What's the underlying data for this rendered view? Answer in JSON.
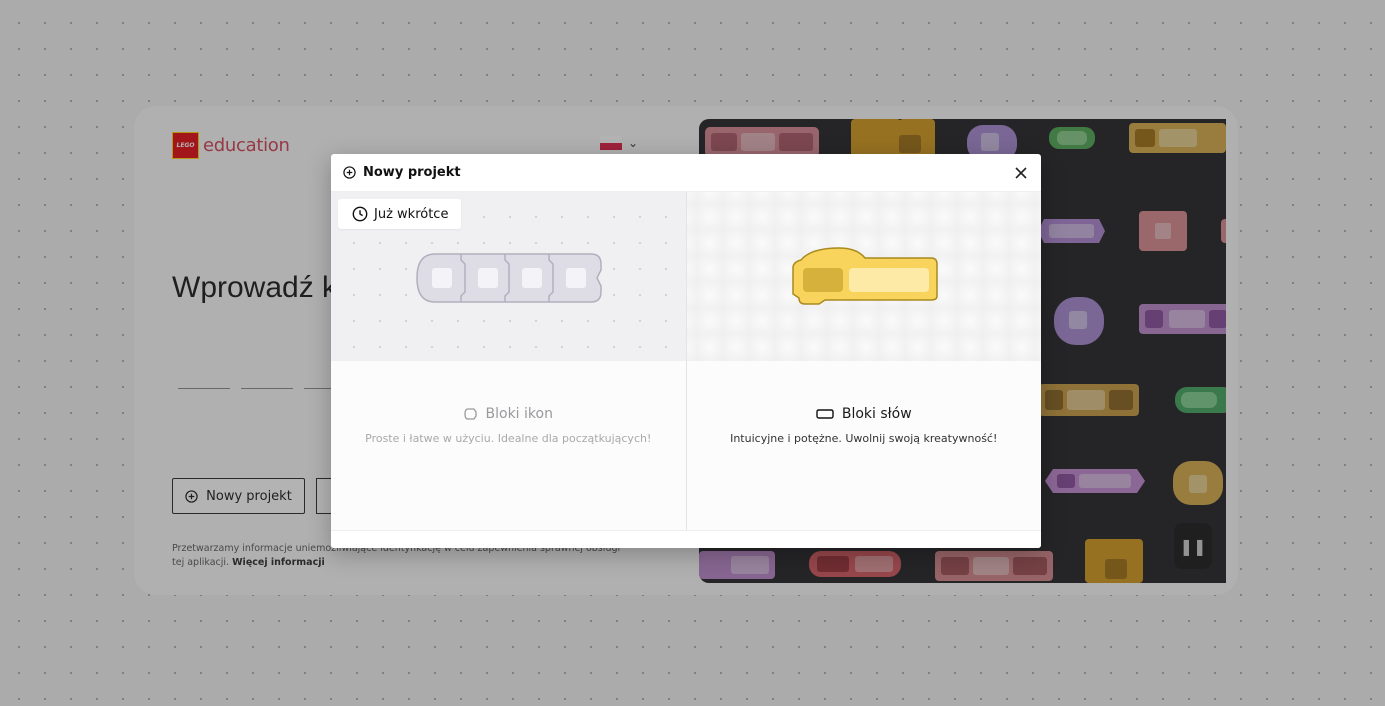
{
  "background": {
    "logo": {
      "badge_text": "LEGO",
      "wordmark": "education"
    },
    "heading": "Wprowadź k",
    "new_project_button": "Nowy projekt",
    "privacy_text": "Przetwarzamy informacje uniemożliwiające identyfikację w celu zapewnienia sprawnej obsługi tej aplikacji.",
    "privacy_link": "Więcej informacji",
    "flag_colors": [
      "#ffffff",
      "#dc143c"
    ]
  },
  "modal": {
    "title": "Nowy projekt",
    "close_icon": "close-icon",
    "options": [
      {
        "badge": "Już wkrótce",
        "title": "Bloki ikon",
        "description": "Proste i łatwe w użyciu. Idealne dla początkujących!",
        "enabled": false
      },
      {
        "title": "Bloki słów",
        "description": "Intuicyjne i potężne. Uwolnij swoją kreatywność!",
        "enabled": true
      }
    ]
  },
  "colors": {
    "word_block": "#f9d45c",
    "word_block_stroke": "#a88a1e",
    "icon_block": "#dedde6",
    "lego_red": "#e3000b"
  }
}
